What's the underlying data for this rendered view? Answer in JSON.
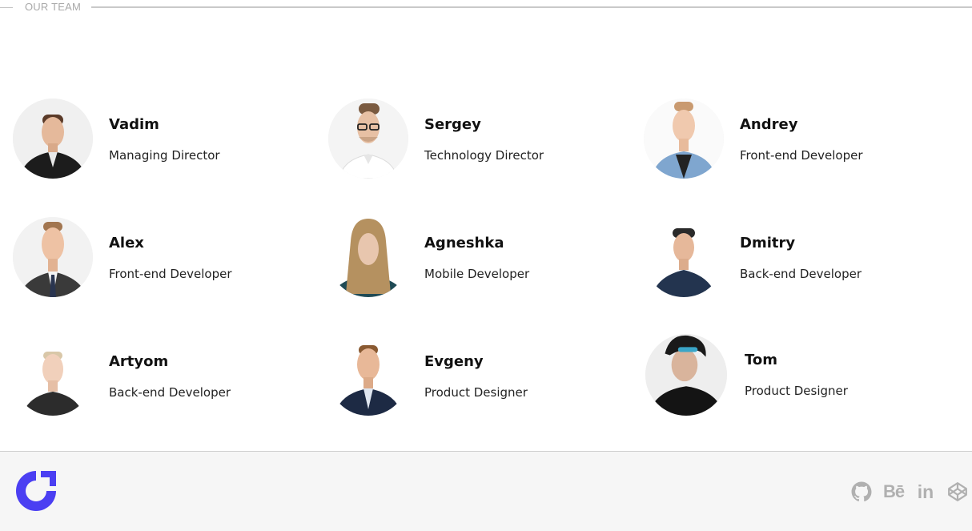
{
  "section": {
    "title": "OUR TEAM"
  },
  "team": [
    {
      "name": "Vadim",
      "role": "Managing Director"
    },
    {
      "name": "Sergey",
      "role": "Technology Director"
    },
    {
      "name": "Andrey",
      "role": "Front-end Developer"
    },
    {
      "name": "Alex",
      "role": "Front-end Developer"
    },
    {
      "name": "Agneshka",
      "role": "Mobile Developer"
    },
    {
      "name": "Dmitry",
      "role": "Back-end Developer"
    },
    {
      "name": "Artyom",
      "role": "Back-end Developer"
    },
    {
      "name": "Evgeny",
      "role": "Product Designer"
    },
    {
      "name": "Tom",
      "role": "Product Designer"
    }
  ],
  "footer": {
    "logo_icon": "company-logo-icon",
    "brand_color": "#4b3ff2",
    "social": {
      "github_icon": "github-icon",
      "behance_label": "Bē",
      "linkedin_label": "in",
      "codepen_icon": "codepen-icon"
    }
  }
}
